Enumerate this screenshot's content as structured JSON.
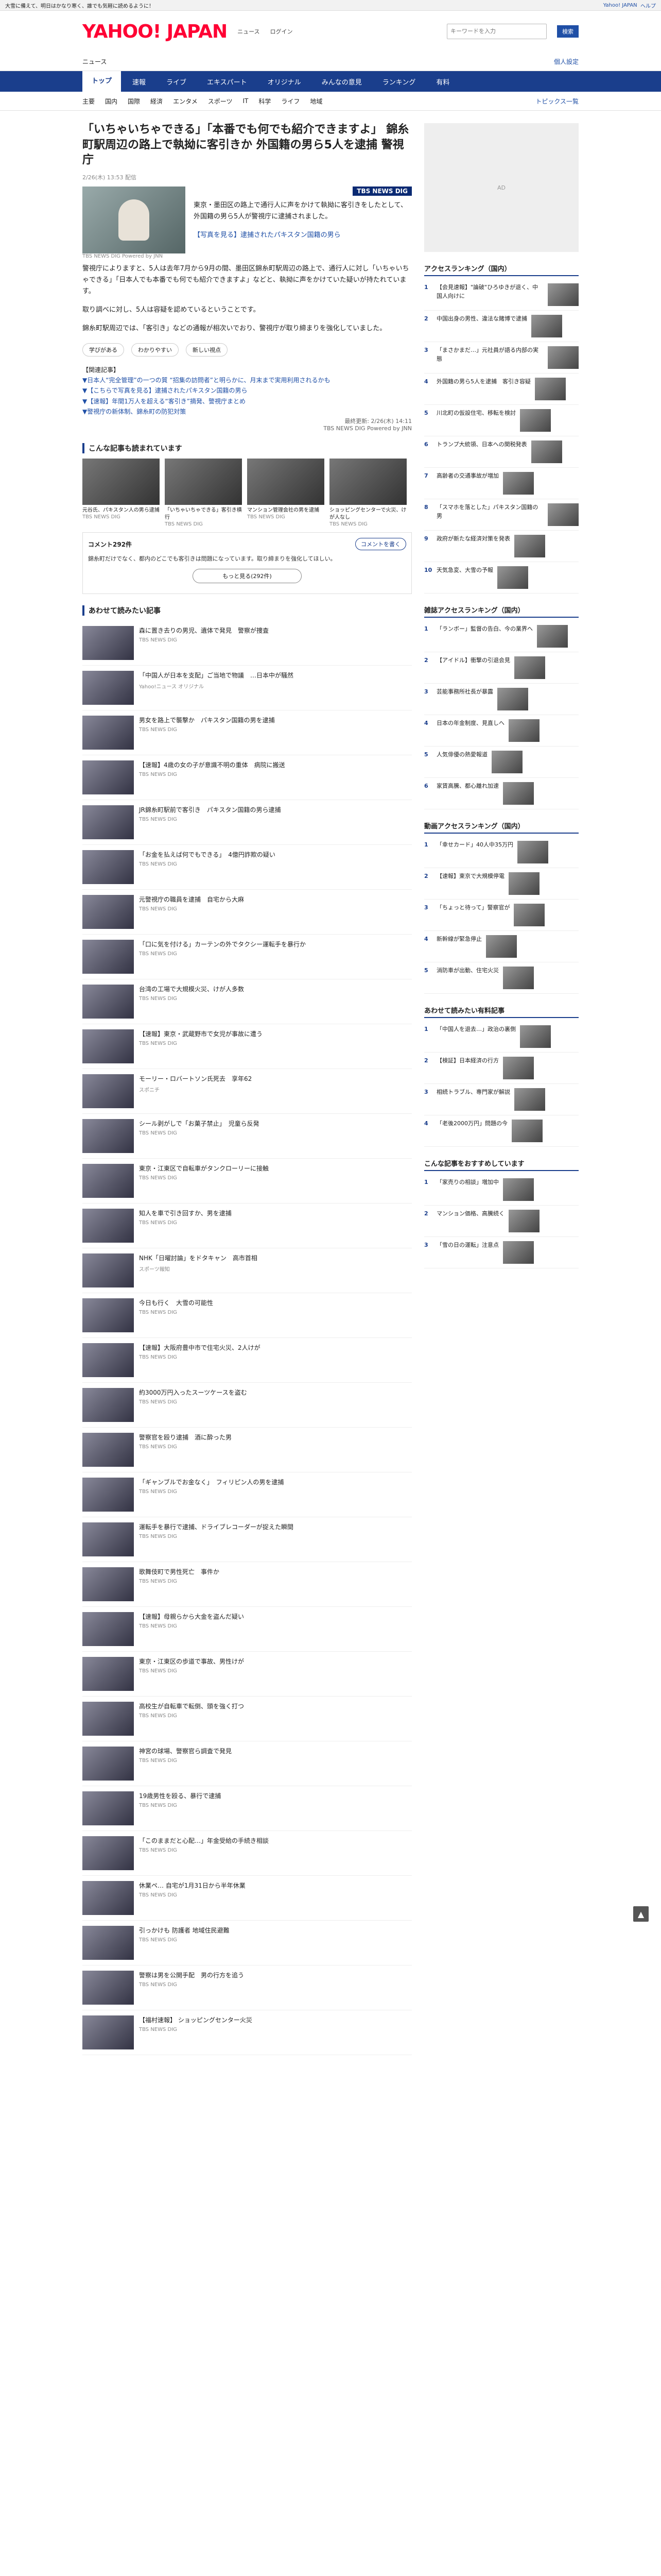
{
  "topbar": {
    "left": "大雪に備えて、明日はかなり寒く、誰でも気軽に読めるように！",
    "right_a": "Yahoo! JAPAN",
    "right_b": "ヘルプ"
  },
  "header": {
    "logo": "YAHOO! JAPAN",
    "service": "ニュース",
    "sub": "ログイン",
    "search_placeholder": "キーワードを入力",
    "search_button": "検索"
  },
  "subhead": {
    "label": "ニュース",
    "right": "個人設定"
  },
  "nav": [
    "トップ",
    "速報",
    "ライブ",
    "エキスパート",
    "オリジナル",
    "みんなの意見",
    "ランキング",
    "有料"
  ],
  "subnav": [
    "主要",
    "国内",
    "国際",
    "経済",
    "エンタメ",
    "スポーツ",
    "IT",
    "科学",
    "ライフ",
    "地域"
  ],
  "subnav_right": "トピックス一覧",
  "article": {
    "title": "「いちゃいちゃできる」「本番でも何でも紹介できますよ」 錦糸町駅周辺の路上で執拗に客引きか 外国籍の男ら5人を逮捕 警視庁",
    "meta_date": "2/26(木) 13:53 配信",
    "caption": "TBS NEWS DIG Powered by JNN",
    "source_badge": "TBS NEWS DIG",
    "lead": "東京・墨田区の路上で通行人に声をかけて執拗に客引きをしたとして、外国籍の男ら5人が警視庁に逮捕されました。",
    "p1": "【写真を見る】逮捕されたパキスタン国籍の男ら",
    "p2": "警視庁によりますと、5人は去年7月から9月の間、墨田区錦糸町駅周辺の路上で、通行人に対し「いちゃいちゃできる」「日本人でも本番でも何でも紹介できますよ」などと、執拗に声をかけていた疑いが持たれています。",
    "p3": "取り調べに対し、5人は容疑を認めているということです。",
    "p4": "錦糸町駅周辺では、「客引き」などの通報が相次いでおり、警視庁が取り締まりを強化していました。",
    "related_head": "【関連記事】",
    "related": [
      "▼日本人“完全管理”の一つの質 “招集の訪問者”と明らかに、月末まで実用利用されるかも",
      "▼【こちらで写真を見る】逮捕されたパキスタン国籍の男ら",
      "▼【速報】年間1万人を超える“客引き”摘発、警視庁まとめ",
      "▼警視庁の新体制、錦糸町の防犯対策"
    ],
    "source_date": "最終更新: 2/26(木) 14:11",
    "source_name": "TBS NEWS DIG Powered by JNN"
  },
  "reactions": [
    "学びがある",
    "わかりやすい",
    "新しい視点"
  ],
  "also_read": {
    "title": "こんな記事も読まれています",
    "items": [
      {
        "t": "元谷氏、パキスタン人の男ら逮捕",
        "m": "TBS NEWS DIG"
      },
      {
        "t": "「いちゃいちゃできる」客引き横行",
        "m": "TBS NEWS DIG"
      },
      {
        "t": "マンション管理会社の男を逮捕",
        "m": "TBS NEWS DIG"
      },
      {
        "t": "ショッピングセンターで火災、けが人なし",
        "m": "TBS NEWS DIG"
      }
    ]
  },
  "comments": {
    "title": "コメント292件",
    "button": "コメントを書く",
    "text": "錦糸町だけでなく、都内のどこでも客引きは問題になっています。取り締まりを強化してほしい。",
    "more": "もっと見る(292件)"
  },
  "recommend": {
    "title": "あわせて読みたい記事",
    "items": [
      {
        "t": "森に置き去りの男児、遺体で発見　警察が捜査",
        "m": "TBS NEWS DIG"
      },
      {
        "t": "「中国人が日本を支配」ご当地で物議　…日本中が騒然",
        "m": "Yahoo!ニュース オリジナル"
      },
      {
        "t": "男女を路上で襲撃か　パキスタン国籍の男を逮捕",
        "m": "TBS NEWS DIG"
      },
      {
        "t": "【速報】4歳の女の子が意識不明の重体　病院に搬送",
        "m": "TBS NEWS DIG"
      },
      {
        "t": "JR錦糸町駅前で客引き　パキスタン国籍の男ら逮捕",
        "m": "TBS NEWS DIG"
      },
      {
        "t": "「お金を払えば何でもできる」　4億円詐欺の疑い",
        "m": "TBS NEWS DIG"
      },
      {
        "t": "元警視庁の職員を逮捕　自宅から大麻",
        "m": "TBS NEWS DIG"
      },
      {
        "t": "「口に気を付ける」カーテンの外でタクシー運転手を暴行か",
        "m": "TBS NEWS DIG"
      },
      {
        "t": "台湾の工場で大規模火災、けが人多数",
        "m": "TBS NEWS DIG"
      },
      {
        "t": "【速報】東京・武蔵野市で女児が事故に遭う",
        "m": "TBS NEWS DIG"
      },
      {
        "t": "モーリー・ロバートソン氏死去　享年62",
        "m": "スポニチ"
      },
      {
        "t": "シール剥がしで「お菓子禁止」　児童ら反発",
        "m": "TBS NEWS DIG"
      },
      {
        "t": "東京・江東区で自転車がタンクローリーに接触",
        "m": "TBS NEWS DIG"
      },
      {
        "t": "知人を車で引き回すか、男を逮捕",
        "m": "TBS NEWS DIG"
      },
      {
        "t": "NHK「日曜討論」をドタキャン　高市首相",
        "m": "スポーツ報知"
      },
      {
        "t": "今日も行く　大雪の可能性",
        "m": "TBS NEWS DIG"
      },
      {
        "t": "【速報】大阪府豊中市で住宅火災、2人けが",
        "m": "TBS NEWS DIG"
      },
      {
        "t": "約3000万円入ったスーツケースを盗む",
        "m": "TBS NEWS DIG"
      },
      {
        "t": "警察官を殴り逮捕　酒に酔った男",
        "m": "TBS NEWS DIG"
      },
      {
        "t": "「ギャンブルでお金なく」　フィリピン人の男を逮捕",
        "m": "TBS NEWS DIG"
      },
      {
        "t": "運転手を暴行で逮捕、ドライブレコーダーが捉えた瞬間",
        "m": "TBS NEWS DIG"
      },
      {
        "t": "歌舞伎町で男性死亡　事件か",
        "m": "TBS NEWS DIG"
      },
      {
        "t": "【速報】母親らから大金を盗んだ疑い",
        "m": "TBS NEWS DIG"
      },
      {
        "t": "東京・江東区の歩道で事故、男性けが",
        "m": "TBS NEWS DIG"
      },
      {
        "t": "高校生が自転車で転倒、頭を強く打つ",
        "m": "TBS NEWS DIG"
      },
      {
        "t": "神宮の球場、警察官ら調査で発見",
        "m": "TBS NEWS DIG"
      },
      {
        "t": "19歳男性を殴る、暴行で逮捕",
        "m": "TBS NEWS DIG"
      },
      {
        "t": "「このままだと心配…」年金受給の手続き相談",
        "m": "TBS NEWS DIG"
      },
      {
        "t": "休業ペ… 自宅が1月31日から半年休業",
        "m": "TBS NEWS DIG"
      },
      {
        "t": "引っかけも 防護者 地域住民避難",
        "m": "TBS NEWS DIG"
      },
      {
        "t": "警察は男を公開手配　男の行方を追う",
        "m": "TBS NEWS DIG"
      },
      {
        "t": "【福村速報】 ショッピングセンター火災",
        "m": "TBS NEWS DIG"
      }
    ]
  },
  "rankings": [
    {
      "title": "アクセスランキング（国内）",
      "items": [
        "【会見速報】\"論破\"ひろゆきが退く、中国人向けに",
        "中国出身の男性、違法な賭博で逮捕",
        "「まさかまだ…」元社員が語る内部の実態",
        "外国籍の男ら5人を逮捕　客引き容疑",
        "川北町の仮設住宅、移転を検討",
        "トランプ大統領、日本への関税発表",
        "高齢者の交通事故が増加",
        "「スマホを落とした」パキスタン国籍の男",
        "政府が新たな経済対策を発表",
        "天気急変、大雪の予報"
      ]
    },
    {
      "title": "雑誌アクセスランキング（国内）",
      "items": [
        "「ランボー」監督の告白、今の業界へ",
        "【アイドル】衝撃の引退会見",
        "芸能事務所社長が暴露",
        "日本の年金制度、見直しへ",
        "人気俳優の熱愛報道",
        "家賃高騰、都心離れ加速"
      ]
    },
    {
      "title": "動画アクセスランキング（国内）",
      "items": [
        "「幸せカード」40人中35万円",
        "【速報】東京で大規模停電",
        "「ちょっと待って」警察官が",
        "新幹線が緊急停止",
        "消防車が出動、住宅火災"
      ]
    },
    {
      "title": "あわせて読みたい有料記事",
      "items": [
        "「中国人を退去…」政治の裏側",
        "【検証】日本経済の行方",
        "相続トラブル、専門家が解説",
        "「老後2000万円」問題の今"
      ]
    },
    {
      "title": "こんな記事をおすすめしています",
      "items": [
        "「家売りの相談」増加中",
        "マンション価格、高騰続く",
        "「雪の日の運転」注意点"
      ]
    }
  ],
  "scroll_top": "▲"
}
